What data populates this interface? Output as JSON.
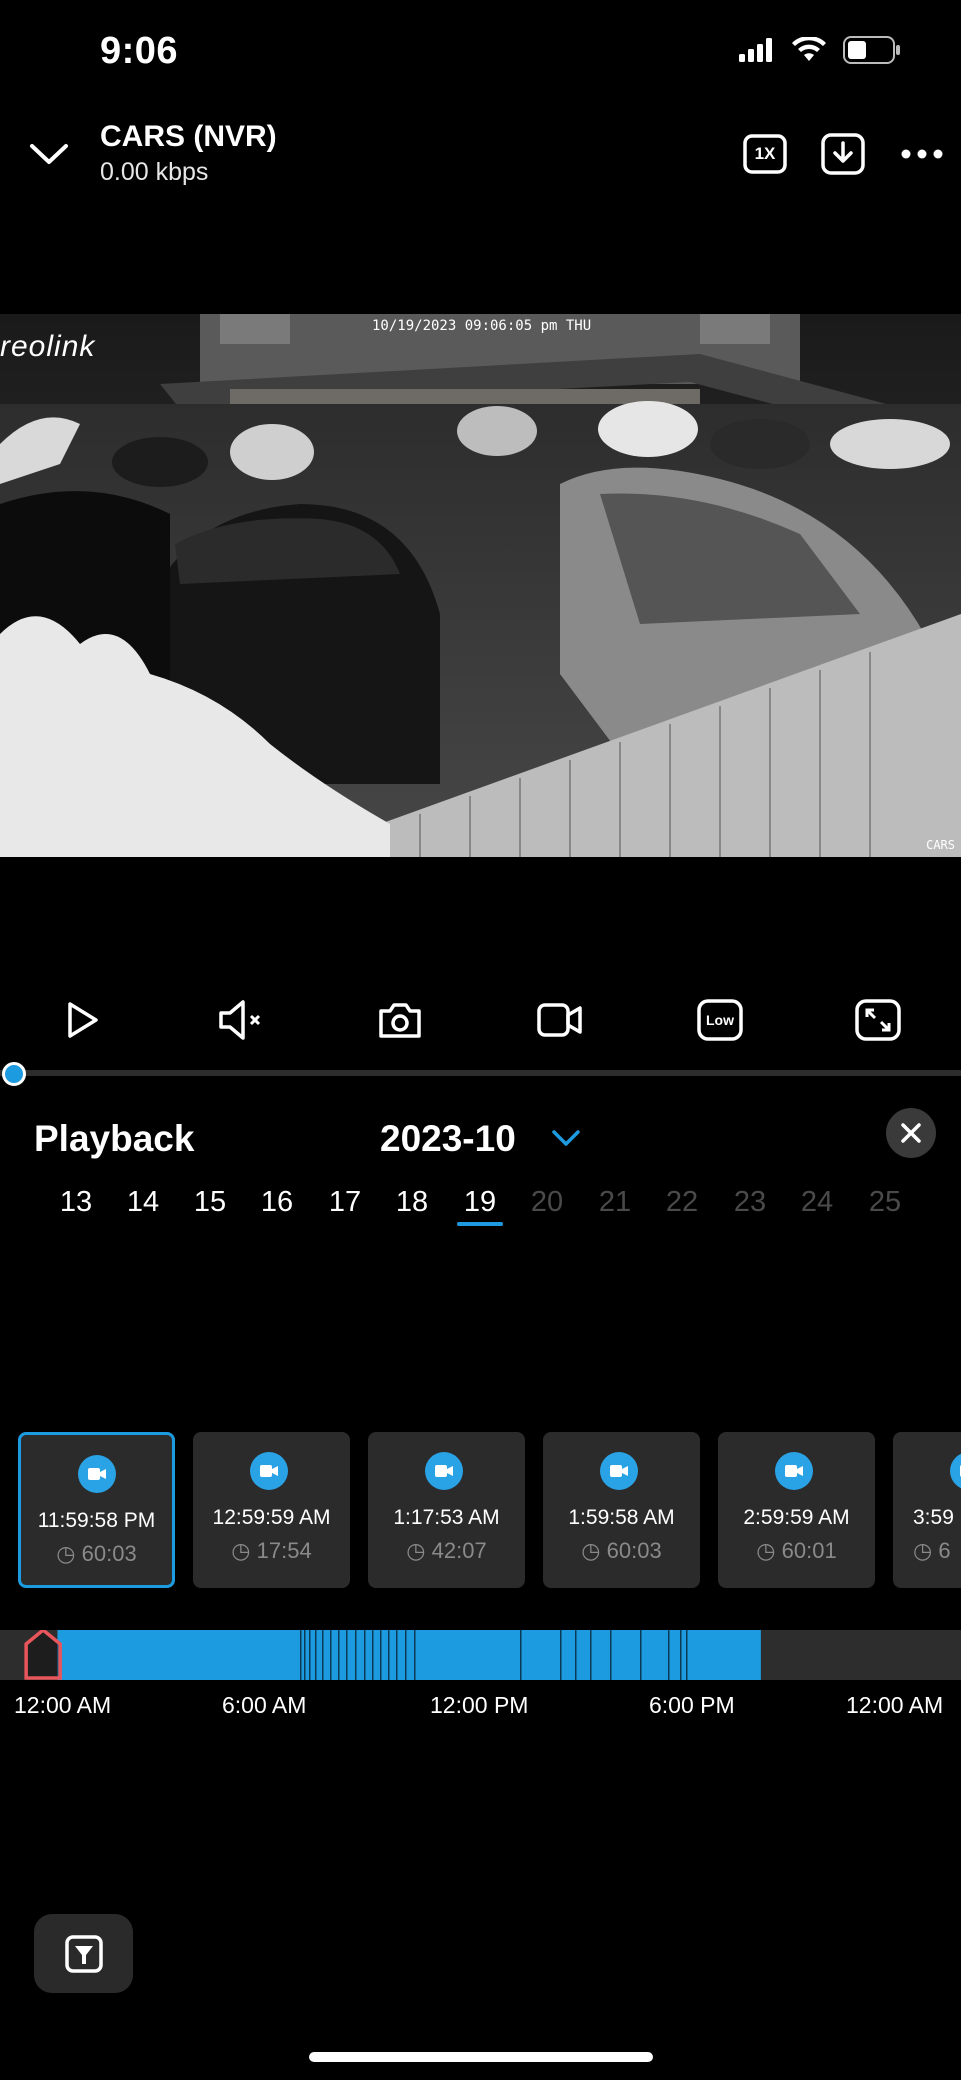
{
  "status_bar": {
    "time": "9:06",
    "icons": [
      "signal-icon",
      "wifi-icon",
      "battery-icon"
    ]
  },
  "header": {
    "camera_name": "CARS (NVR)",
    "bitrate": "0.00 kbps",
    "speed_label": "1X",
    "icons": [
      "chevron-down-icon",
      "speed-icon",
      "download-icon",
      "more-icon"
    ]
  },
  "video": {
    "osd_timestamp": "10/19/2023 09:06:05 pm THU",
    "osd_channel": "CARS",
    "watermark": "reolink"
  },
  "controls": {
    "quality_label": "Low",
    "icons": [
      "play-icon",
      "mute-icon",
      "snapshot-icon",
      "record-icon",
      "quality-icon",
      "fullscreen-icon"
    ],
    "progress_fraction": 0.0
  },
  "playback": {
    "title": "Playback",
    "month": "2023-10",
    "selected_day": "19",
    "days": [
      {
        "label": "13",
        "state": "past"
      },
      {
        "label": "14",
        "state": "past"
      },
      {
        "label": "15",
        "state": "past"
      },
      {
        "label": "16",
        "state": "past"
      },
      {
        "label": "17",
        "state": "past"
      },
      {
        "label": "18",
        "state": "past"
      },
      {
        "label": "19",
        "state": "selected"
      },
      {
        "label": "20",
        "state": "future"
      },
      {
        "label": "21",
        "state": "future"
      },
      {
        "label": "22",
        "state": "future"
      },
      {
        "label": "23",
        "state": "future"
      },
      {
        "label": "24",
        "state": "future"
      },
      {
        "label": "25",
        "state": "future"
      }
    ],
    "clips": [
      {
        "time": "11:59:58 PM",
        "duration": "60:03",
        "selected": true
      },
      {
        "time": "12:59:59 AM",
        "duration": "17:54",
        "selected": false
      },
      {
        "time": "1:17:53 AM",
        "duration": "42:07",
        "selected": false
      },
      {
        "time": "1:59:58 AM",
        "duration": "60:03",
        "selected": false
      },
      {
        "time": "2:59:59 AM",
        "duration": "60:01",
        "selected": false
      },
      {
        "time": "3:59",
        "duration": "6",
        "selected": false
      }
    ],
    "timeline": {
      "labels": [
        "12:00 AM",
        "6:00 AM",
        "12:00 PM",
        "6:00 PM",
        "12:00 AM"
      ],
      "recorded_from_hour": 0.6,
      "recorded_to_hour": 20.3,
      "cursor_hour": 0.2
    }
  },
  "colors": {
    "accent": "#1d9be0",
    "cursor": "#e8565b",
    "card_bg": "#2b2b2b",
    "future_day": "#4a4a4a"
  }
}
